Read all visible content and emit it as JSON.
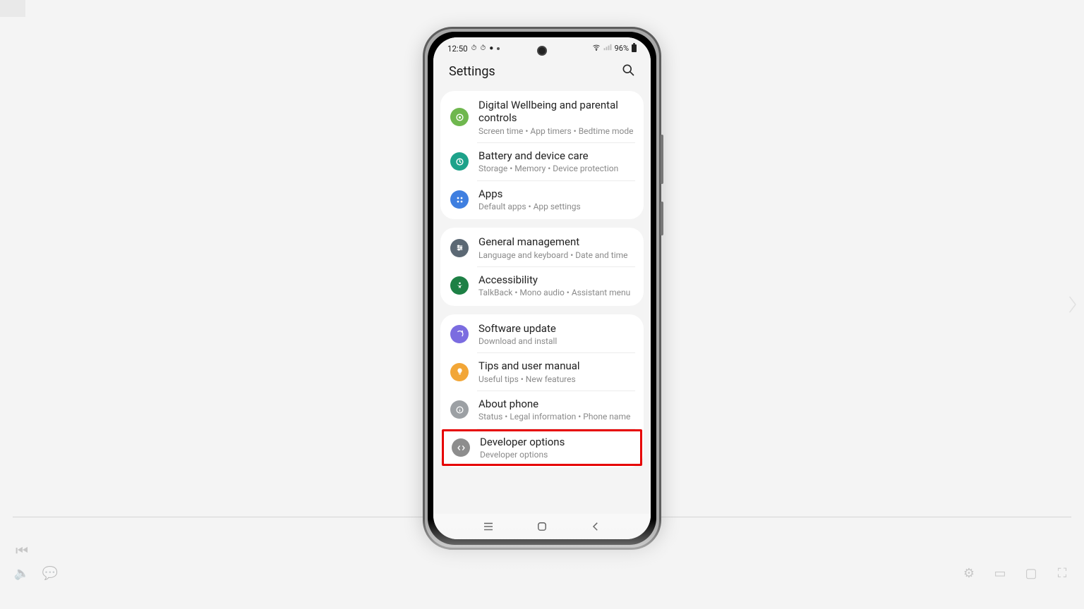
{
  "status": {
    "time": "12:50",
    "battery_pct": "96%"
  },
  "header": {
    "title": "Settings"
  },
  "groups": [
    {
      "items": [
        {
          "key": "wellbeing",
          "icon": "wellbeing",
          "title": "Digital Wellbeing and parental controls",
          "subtitle": "Screen time  •  App timers  •  Bedtime mode"
        },
        {
          "key": "battery",
          "icon": "battery",
          "title": "Battery and device care",
          "subtitle": "Storage  •  Memory  •  Device protection"
        },
        {
          "key": "apps",
          "icon": "apps",
          "title": "Apps",
          "subtitle": "Default apps  •  App settings"
        }
      ]
    },
    {
      "items": [
        {
          "key": "general",
          "icon": "general",
          "title": "General management",
          "subtitle": "Language and keyboard  •  Date and time"
        },
        {
          "key": "access",
          "icon": "access",
          "title": "Accessibility",
          "subtitle": "TalkBack  •  Mono audio  •  Assistant menu"
        }
      ]
    },
    {
      "items": [
        {
          "key": "update",
          "icon": "update",
          "title": "Software update",
          "subtitle": "Download and install"
        },
        {
          "key": "tips",
          "icon": "tips",
          "title": "Tips and user manual",
          "subtitle": "Useful tips  •  New features"
        },
        {
          "key": "about",
          "icon": "about",
          "title": "About phone",
          "subtitle": "Status  •  Legal information  •  Phone name"
        },
        {
          "key": "dev",
          "icon": "dev",
          "title": "Developer options",
          "subtitle": "Developer options",
          "highlight": true
        }
      ]
    }
  ]
}
